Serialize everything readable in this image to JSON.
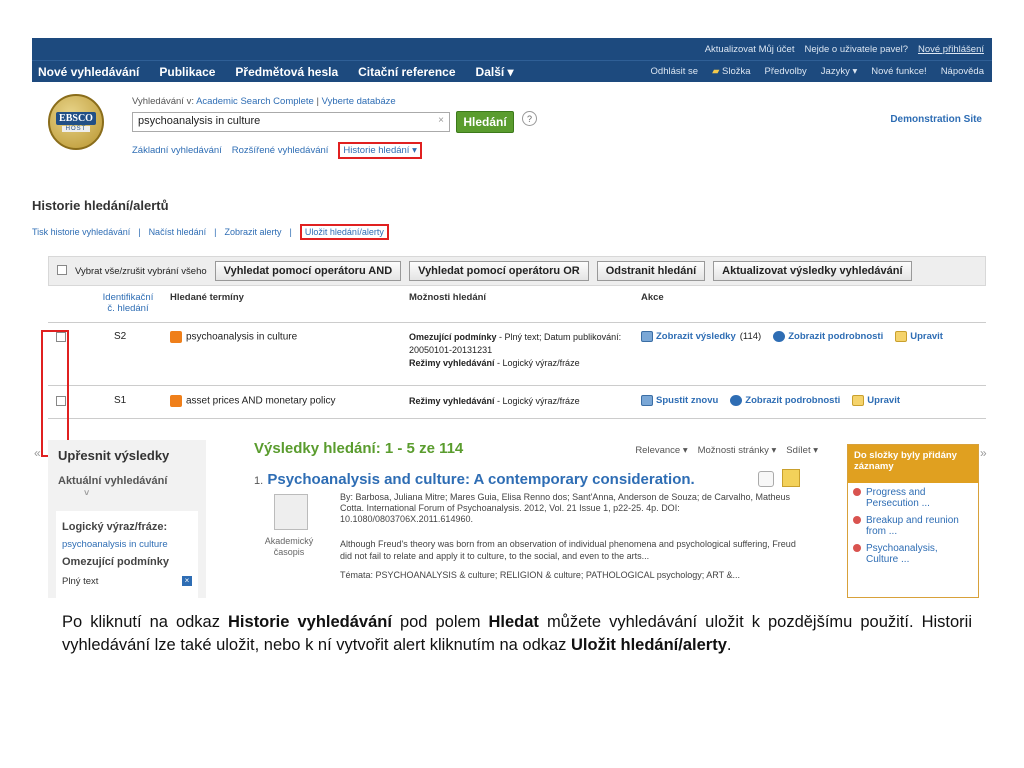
{
  "topbar": {
    "update_account": "Aktualizovat Můj účet",
    "not_user": "Nejde o uživatele pavel?",
    "new_login": "Nové přihlášení"
  },
  "nav": {
    "items": [
      "Nové vyhledávání",
      "Publikace",
      "Předmětová hesla",
      "Citační reference",
      "Další ▾"
    ],
    "right": [
      "Odhlásit se",
      "Složka",
      "Předvolby",
      "Jazyky ▾",
      "Nové funkce!",
      "Nápověda"
    ]
  },
  "header": {
    "logo_word": "EBSCO",
    "logo_host": "HOST",
    "search_in_prefix": "Vyhledávání v:",
    "database": "Academic Search Complete",
    "choose_db": "Vyberte databáze",
    "query": "psychoanalysis in culture",
    "clear": "×",
    "search_button": "Hledání",
    "help": "?",
    "basic_search": "Základní vyhledávání",
    "advanced_search": "Rozšířené vyhledávání",
    "history_link": "Historie hledání ▾",
    "demo": "Demonstration Site"
  },
  "history": {
    "title": "Historie hledání/alertů",
    "links": [
      "Tisk historie vyhledávání",
      "Načíst hledání",
      "Zobrazit alerty",
      "Uložit hledání/alerty"
    ],
    "select_all": "Vybrat vše/zrušit vybrání všeho",
    "buttons": [
      "Vyhledat pomocí operátoru AND",
      "Vyhledat pomocí operátoru OR",
      "Odstranit hledání",
      "Aktualizovat výsledky vyhledávání"
    ],
    "columns": {
      "id": "Identifikační č. hledání",
      "terms": "Hledané termíny",
      "options": "Možnosti hledání",
      "actions": "Akce"
    },
    "rows": [
      {
        "id": "S2",
        "terms": "psychoanalysis in culture",
        "limits_label": "Omezující podmínky",
        "limits": " - Plný text; Datum publikování: 20050101-20131231",
        "modes_label": "Režimy vyhledávání",
        "modes": " - Logický výraz/fráze",
        "actions": [
          "Zobrazit výsledky",
          "(114)",
          "Zobrazit podrobnosti",
          "Upravit"
        ]
      },
      {
        "id": "S1",
        "terms": "asset prices AND monetary policy",
        "modes_label": "Režimy vyhledávání",
        "modes": " - Logický výraz/fráze",
        "actions": [
          "Spustit znovu",
          "Zobrazit podrobnosti",
          "Upravit"
        ]
      }
    ]
  },
  "left": {
    "title": "Upřesnit výsledky",
    "current": "Aktuální vyhledávání",
    "bool_label": "Logický výraz/fráze:",
    "bool_value": "psychoanalysis in culture",
    "limits_label": "Omezující podmínky",
    "fulltext": "Plný text"
  },
  "results": {
    "title": "Výsledky hledání: 1 - 5 ze 114",
    "sort": "Relevance ▾",
    "page_options": "Možnosti stránky ▾",
    "share": "Sdílet ▾",
    "item1": {
      "num": "1.",
      "title": "Psychoanalysis and culture: A contemporary consideration.",
      "byline": "By: Barbosa, Juliana Mitre; Mares Guia, Elisa Renno dos; Sant'Anna, Anderson de Souza; de Carvalho, Matheus Cotta. International Forum of Psychoanalysis. 2012, Vol. 21 Issue 1, p22-25. 4p. DOI: 10.1080/0803706X.2011.614960.",
      "type": "Akademický časopis",
      "abstract": "Although Freud's theory was born from an observation of individual phenomena and psychological suffering, Freud did not fail to relate and apply it to culture, to the social, and even to the arts...",
      "subjects": "Témata: PSYCHOANALYSIS & culture; RELIGION & culture; PATHOLOGICAL psychology; ART &..."
    }
  },
  "folder": {
    "header": "Do složky byly přidány záznamy",
    "items": [
      "Progress and Persecution ...",
      "Breakup and reunion from ...",
      "Psychoanalysis, Culture ..."
    ]
  },
  "caption": {
    "p1": "Po kliknutí na odkaz ",
    "b1": "Historie vyhledávání",
    "p2": " pod polem ",
    "b2": "Hledat",
    "p3": " můžete vyhledávání uložit k pozdějšímu použití. Historii vyhledávání lze také uložit, nebo k ní vytvořit alert kliknutím na odkaz ",
    "b3": "Uložit hledání/alerty",
    "p4": "."
  }
}
